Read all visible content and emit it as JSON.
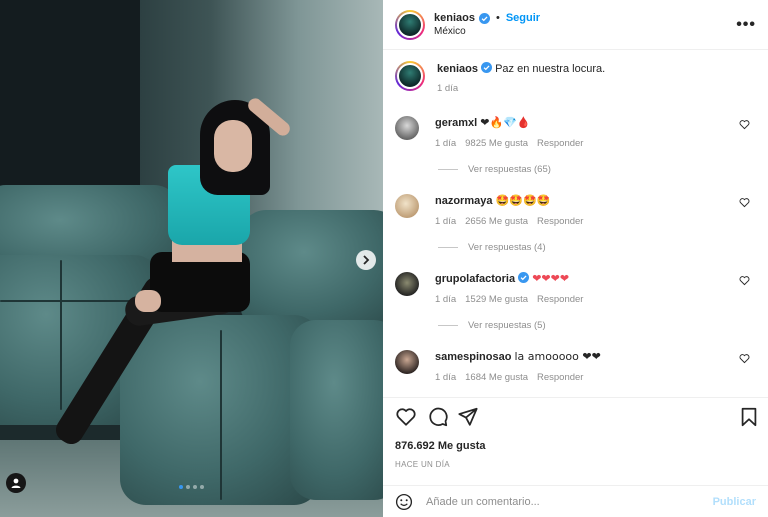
{
  "post": {
    "username": "keniaos",
    "bullet": "•",
    "follow_label": "Seguir",
    "location": "México",
    "more_label": "•••"
  },
  "caption": {
    "username": "keniaos",
    "text": "Paz en nuestra locura.",
    "time": "1 día"
  },
  "comments": [
    {
      "username": "geramxl",
      "text": "❤🔥💎🩸",
      "time": "1 día",
      "likes": "9825 Me gusta",
      "reply_label": "Responder",
      "verified": false,
      "replies_label": "Ver respuestas (65)"
    },
    {
      "username": "nazormaya",
      "text": "🤩🤩🤩🤩",
      "time": "1 día",
      "likes": "2656 Me gusta",
      "reply_label": "Responder",
      "verified": false,
      "replies_label": "Ver respuestas (4)"
    },
    {
      "username": "grupolafactoria",
      "text": "❤❤❤❤",
      "time": "1 día",
      "likes": "1529 Me gusta",
      "reply_label": "Responder",
      "verified": true,
      "replies_label": "Ver respuestas (5)"
    },
    {
      "username": "samespinosao",
      "text": "la amooooo ❤❤",
      "time": "1 día",
      "likes": "1684 Me gusta",
      "reply_label": "Responder",
      "verified": false,
      "replies_label": ""
    }
  ],
  "footer": {
    "likes": "876.692 Me gusta",
    "time_ago": "HACE UN DÍA",
    "comment_placeholder": "Añade un comentario...",
    "publish_label": "Publicar"
  },
  "carousel": {
    "slides": 4,
    "active": 1
  },
  "colors": {
    "accent": "#0095f6",
    "verified": "#3897f0",
    "publish_disabled": "#b2dffc",
    "heart_red": "#ed4956"
  }
}
